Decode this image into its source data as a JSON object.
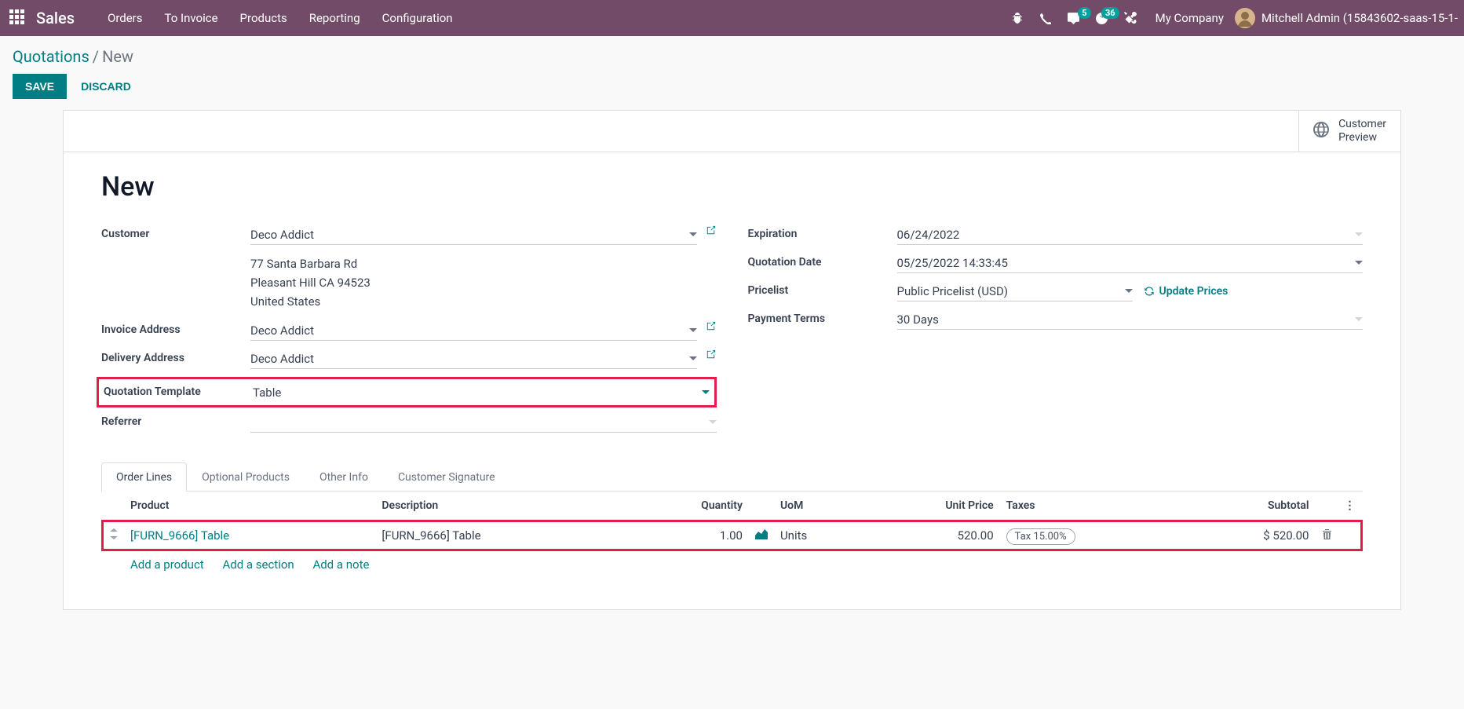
{
  "topbar": {
    "brand": "Sales",
    "menu": [
      "Orders",
      "To Invoice",
      "Products",
      "Reporting",
      "Configuration"
    ],
    "chat_badge": "5",
    "clock_badge": "36",
    "company": "My Company",
    "user": "Mitchell Admin (15843602-saas-15-1-"
  },
  "breadcrumb": {
    "root": "Quotations",
    "current": "New"
  },
  "buttons": {
    "save": "SAVE",
    "discard": "DISCARD"
  },
  "statusbar": {
    "cp1": "Customer",
    "cp2": "Preview"
  },
  "title": "New",
  "left": {
    "customer_label": "Customer",
    "customer": "Deco Addict",
    "addr1": "77 Santa Barbara Rd",
    "addr2": "Pleasant Hill CA 94523",
    "addr3": "United States",
    "invoice_label": "Invoice Address",
    "invoice": "Deco Addict",
    "delivery_label": "Delivery Address",
    "delivery": "Deco Addict",
    "template_label": "Quotation Template",
    "template": "Table",
    "referrer_label": "Referrer"
  },
  "right": {
    "expiration_label": "Expiration",
    "expiration": "06/24/2022",
    "qdate_label": "Quotation Date",
    "qdate": "05/25/2022 14:33:45",
    "pricelist_label": "Pricelist",
    "pricelist": "Public Pricelist (USD)",
    "update_prices": "Update Prices",
    "terms_label": "Payment Terms",
    "terms": "30 Days"
  },
  "tabs": [
    "Order Lines",
    "Optional Products",
    "Other Info",
    "Customer Signature"
  ],
  "cols": {
    "product": "Product",
    "desc": "Description",
    "qty": "Quantity",
    "uom": "UoM",
    "price": "Unit Price",
    "taxes": "Taxes",
    "subtotal": "Subtotal"
  },
  "row": {
    "product": "[FURN_9666] Table",
    "desc": "[FURN_9666] Table",
    "qty": "1.00",
    "uom": "Units",
    "price": "520.00",
    "tax": "Tax 15.00%",
    "subtotal": "$ 520.00"
  },
  "add": {
    "product": "Add a product",
    "section": "Add a section",
    "note": "Add a note"
  }
}
